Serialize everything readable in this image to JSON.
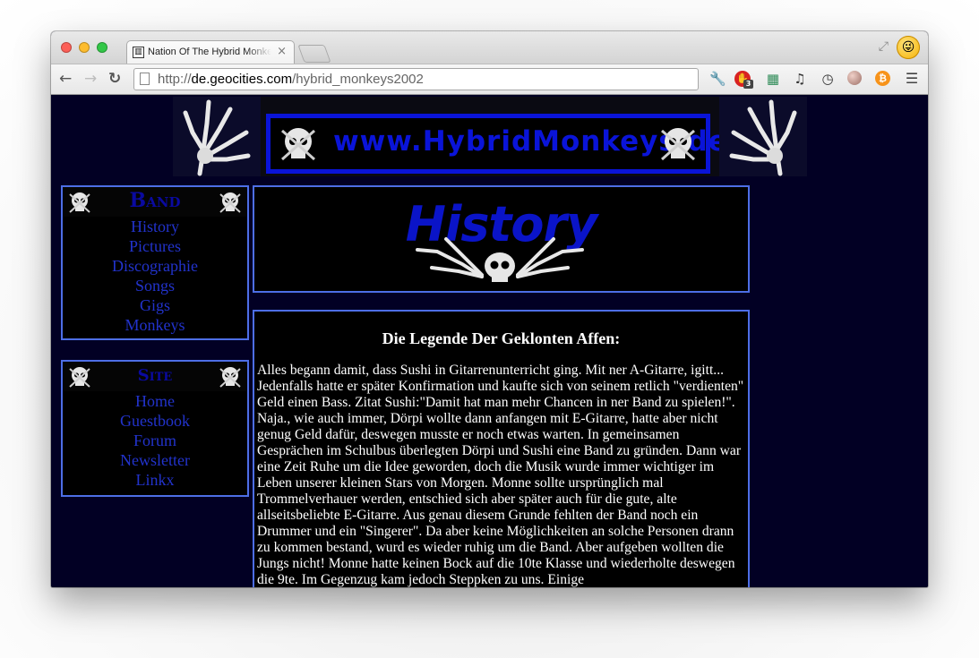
{
  "browser": {
    "tab_title": "Nation Of The Hybrid Monkeys",
    "tab_close": "×",
    "url_prefix": "http://",
    "url_host": "de.geocities.com",
    "url_path": "/hybrid_monkeys2002",
    "adblock_count": "3",
    "icons": [
      "back-arrow-icon",
      "forward-arrow-icon",
      "reload-icon",
      "page-icon",
      "wrench-icon",
      "adblock-icon",
      "cube-icon",
      "music-icon",
      "clock-icon",
      "ball-icon",
      "bitcoin-icon",
      "menu-icon",
      "fullscreen-icon",
      "profile-icon"
    ]
  },
  "banner": {
    "logo_text": "www.HybridMonkeys.de"
  },
  "nav_band": {
    "title": "Band",
    "items": [
      "History",
      "Pictures",
      "Discographie",
      "Songs",
      "Gigs",
      "Monkeys"
    ]
  },
  "nav_site": {
    "title": "Site",
    "items": [
      "Home",
      "Guestbook",
      "Forum",
      "Newsletter",
      "Linkx"
    ]
  },
  "history": {
    "heading": "History"
  },
  "article": {
    "title": "Die Legende Der Geklonten Affen:",
    "body": "Alles begann damit, dass Sushi in Gitarrenunterricht ging. Mit ner A-Gitarre, igitt... Jedenfalls hatte er später Konfirmation und kaufte sich von seinem retlich \"verdienten\" Geld einen Bass. Zitat Sushi:\"Damit hat man mehr Chancen in ner Band zu spielen!\". Naja., wie auch immer, Dörpi wollte dann anfangen mit E-Gitarre, hatte aber nicht genug Geld dafür, deswegen musste er noch etwas warten. In gemeinsamen Gesprächen im Schulbus überlegten Dörpi und Sushi eine Band zu gründen. Dann war eine Zeit Ruhe um die Idee geworden, doch die Musik wurde immer wichtiger im Leben unserer kleinen Stars von Morgen. Monne sollte ursprünglich mal Trommelverhauer werden, entschied sich aber später auch für die gute, alte allseitsbeliebte E-Gitarre. Aus genau diesem Grunde fehlten der Band noch ein Drummer und ein \"Singerer\". Da aber keine Möglichkeiten an solche Personen drann zu kommen bestand, wurd es wieder ruhig um die Band. Aber aufgeben wollten die Jungs nicht! Monne hatte keinen Bock auf die 10te Klasse und wiederholte deswegen die 9te. Im Gegenzug kam jedoch Steppken zu uns. Einige"
  },
  "colors": {
    "page_bg": "#020024",
    "border": "#4d6ee6",
    "link": "#2233cc",
    "logo_blue": "#0a14d8"
  }
}
